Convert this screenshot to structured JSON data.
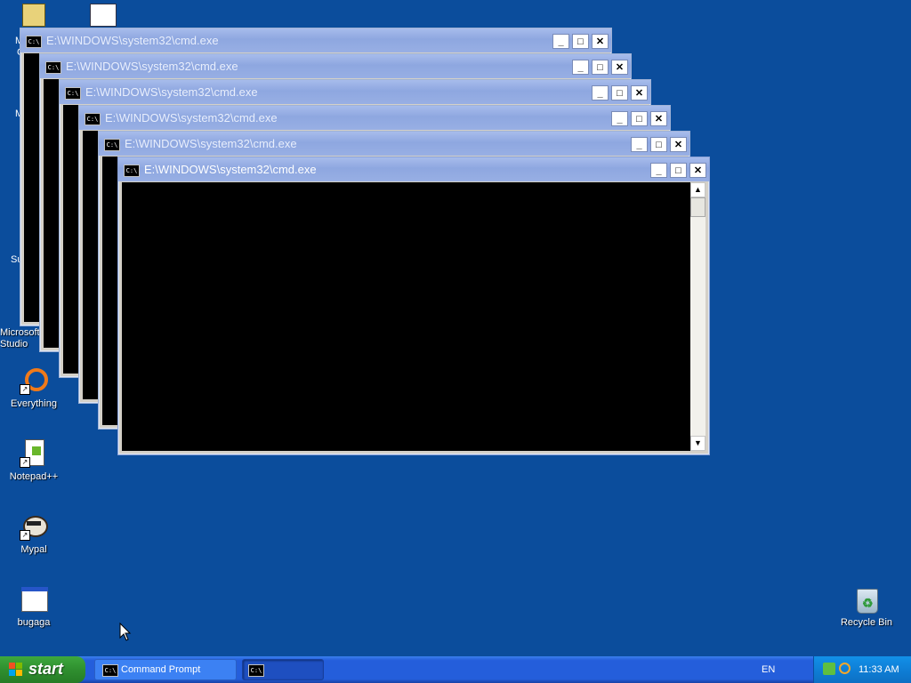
{
  "desktop": {
    "icons": [
      {
        "label": "Everything"
      },
      {
        "label": "Notepad++"
      },
      {
        "label": "Mypal"
      },
      {
        "label": "bugaga"
      },
      {
        "label": "Recycle Bin"
      },
      {
        "label": "Microsoft Studio"
      }
    ],
    "partial_labels": [
      "M",
      "C",
      "M",
      "Su"
    ]
  },
  "windows": [
    {
      "title": "E:\\WINDOWS\\system32\\cmd.exe"
    },
    {
      "title": "E:\\WINDOWS\\system32\\cmd.exe"
    },
    {
      "title": "E:\\WINDOWS\\system32\\cmd.exe"
    },
    {
      "title": "E:\\WINDOWS\\system32\\cmd.exe"
    },
    {
      "title": "E:\\WINDOWS\\system32\\cmd.exe"
    },
    {
      "title": "E:\\WINDOWS\\system32\\cmd.exe"
    }
  ],
  "window_buttons": {
    "minimize": "_",
    "maximize": "□",
    "close": "✕"
  },
  "console_icon_text": "C:\\",
  "scroll": {
    "up": "▲",
    "down": "▼"
  },
  "taskbar": {
    "start_label": "start",
    "tasks": [
      {
        "label": "Command Prompt",
        "icon": "cmd-icon"
      },
      {
        "label": "",
        "icon": "cmd-icon"
      }
    ],
    "language": "EN",
    "clock": "11:33 AM"
  },
  "colors": {
    "desktop": "#0b4d9c",
    "titlebar_inactive": "#98afe4",
    "start_green": "#2f8f2f"
  }
}
